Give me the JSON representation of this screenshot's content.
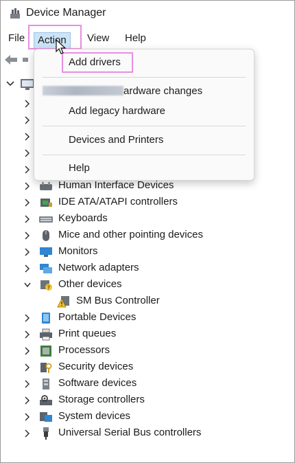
{
  "window": {
    "title": "Device Manager"
  },
  "menubar": {
    "file": "File",
    "action": "Action",
    "view": "View",
    "help": "Help"
  },
  "popup": {
    "items": [
      "Add drivers",
      "ardware changes",
      "Add legacy hardware",
      "Devices and Printers",
      "Help"
    ]
  },
  "tree": {
    "categories": [
      {
        "label": "Human Interface Devices",
        "icon": "hid-icon"
      },
      {
        "label": "IDE ATA/ATAPI controllers",
        "icon": "ide-controller-icon"
      },
      {
        "label": "Keyboards",
        "icon": "keyboard-icon"
      },
      {
        "label": "Mice and other pointing devices",
        "icon": "mouse-icon"
      },
      {
        "label": "Monitors",
        "icon": "monitor-icon"
      },
      {
        "label": "Network adapters",
        "icon": "network-adapter-icon"
      },
      {
        "label": "Other devices",
        "icon": "unknown-device-icon",
        "expanded": true
      },
      {
        "label": "SM Bus Controller",
        "icon": "warning-device-icon",
        "child": true
      },
      {
        "label": "Portable Devices",
        "icon": "portable-device-icon"
      },
      {
        "label": "Print queues",
        "icon": "printer-icon"
      },
      {
        "label": "Processors",
        "icon": "processor-icon"
      },
      {
        "label": "Security devices",
        "icon": "security-device-icon"
      },
      {
        "label": "Software devices",
        "icon": "software-device-icon"
      },
      {
        "label": "Storage controllers",
        "icon": "storage-controller-icon"
      },
      {
        "label": "System devices",
        "icon": "system-device-icon"
      },
      {
        "label": "Universal Serial Bus controllers",
        "icon": "usb-icon"
      }
    ]
  },
  "colors": {
    "highlight": "#e88ee0",
    "menu_selected": "#cce4f7"
  }
}
